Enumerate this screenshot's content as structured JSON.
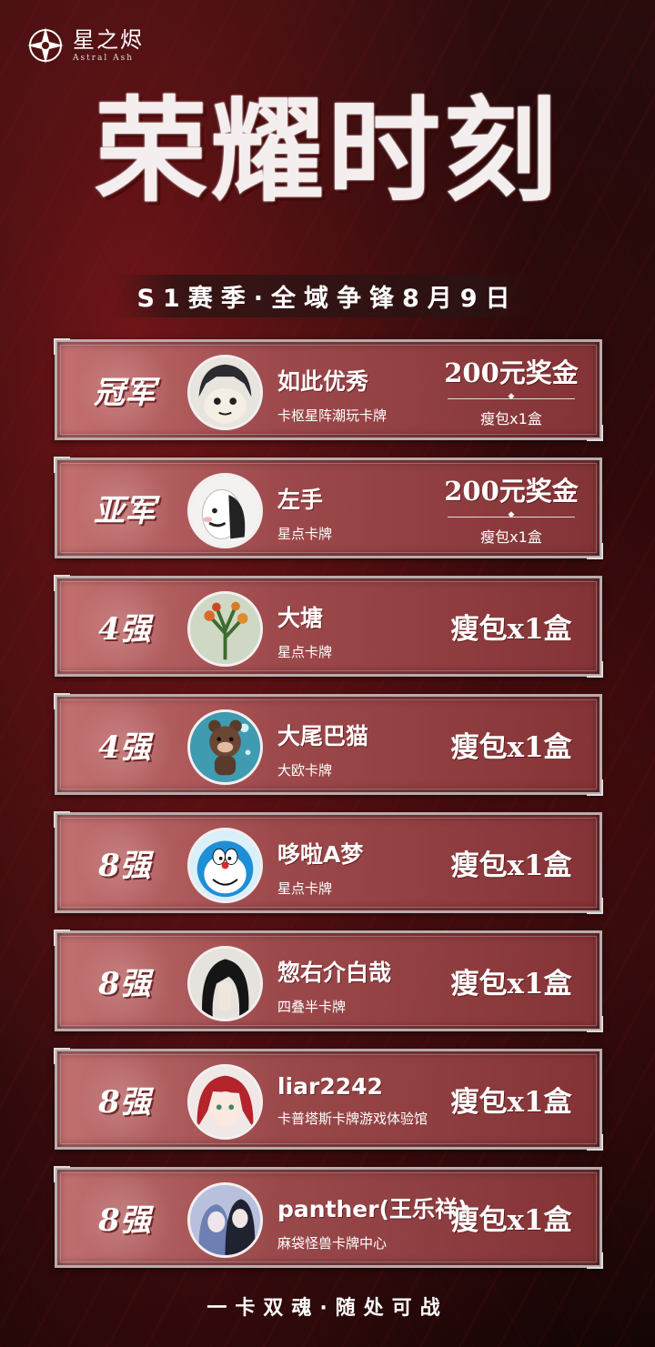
{
  "brand": {
    "name_cn": "星之烬",
    "name_en": "Astral Ash"
  },
  "title": "荣耀时刻",
  "subtitle": "S1赛季·全域争锋8月9日",
  "results": [
    {
      "rank": "冠军",
      "player": "如此优秀",
      "club": "卡枢星阵潮玩卡牌",
      "prize_main": "200元奖金",
      "prize_sub": "瘦包x1盒",
      "avatar_icon": "anime-boy-avatar-icon"
    },
    {
      "rank": "亚军",
      "player": "左手",
      "club": "星点卡牌",
      "prize_main": "200元奖金",
      "prize_sub": "瘦包x1盒",
      "avatar_icon": "meme-face-avatar-icon"
    },
    {
      "rank": "4强",
      "player": "大塘",
      "club": "星点卡牌",
      "prize_main": "瘦包x1盒",
      "prize_sub": null,
      "avatar_icon": "plant-avatar-icon"
    },
    {
      "rank": "4强",
      "player": "大尾巴猫",
      "club": "大欧卡牌",
      "prize_main": "瘦包x1盒",
      "prize_sub": null,
      "avatar_icon": "bear-doll-avatar-icon"
    },
    {
      "rank": "8强",
      "player": "哆啦A梦",
      "club": "星点卡牌",
      "prize_main": "瘦包x1盒",
      "prize_sub": null,
      "avatar_icon": "doraemon-avatar-icon"
    },
    {
      "rank": "8强",
      "player": "惣右介白哉",
      "club": "四叠半卡牌",
      "prize_main": "瘦包x1盒",
      "prize_sub": null,
      "avatar_icon": "dark-hair-avatar-icon"
    },
    {
      "rank": "8强",
      "player": "liar2242",
      "club": "卡普塔斯卡牌游戏体验馆",
      "prize_main": "瘦包x1盒",
      "prize_sub": null,
      "avatar_icon": "red-hair-avatar-icon"
    },
    {
      "rank": "8强",
      "player": "panther(王乐祥)",
      "club": "麻袋怪兽卡牌中心",
      "prize_main": "瘦包x1盒",
      "prize_sub": null,
      "avatar_icon": "couple-avatar-icon"
    }
  ],
  "footer": "一卡双魂·随处可战",
  "colors": {
    "card_light": "#cd7878",
    "card_dark": "#8c373a",
    "background": "#1b0707",
    "frame": "#b9acac"
  }
}
